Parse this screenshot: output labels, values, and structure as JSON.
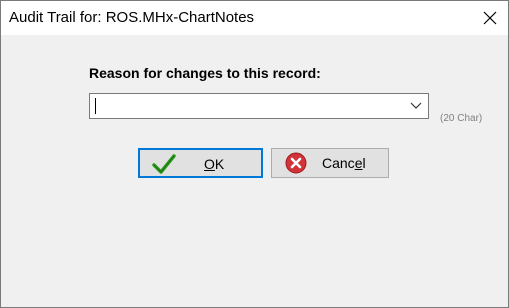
{
  "window": {
    "title": "Audit Trail for: ROS.MHx-ChartNotes"
  },
  "form": {
    "reason_label": "Reason for changes to this record:",
    "reason_value": "",
    "char_limit_hint": "(20 Char)"
  },
  "buttons": {
    "ok": {
      "pre": "",
      "accel": "O",
      "post": "K",
      "icon": "checkmark-icon"
    },
    "cancel": {
      "pre": "Canc",
      "accel": "e",
      "post": "l",
      "icon": "cancel-x-icon"
    }
  },
  "colors": {
    "focus_border": "#0078d7",
    "ok_check": "#2e9e1f",
    "cancel_red": "#d13438"
  }
}
